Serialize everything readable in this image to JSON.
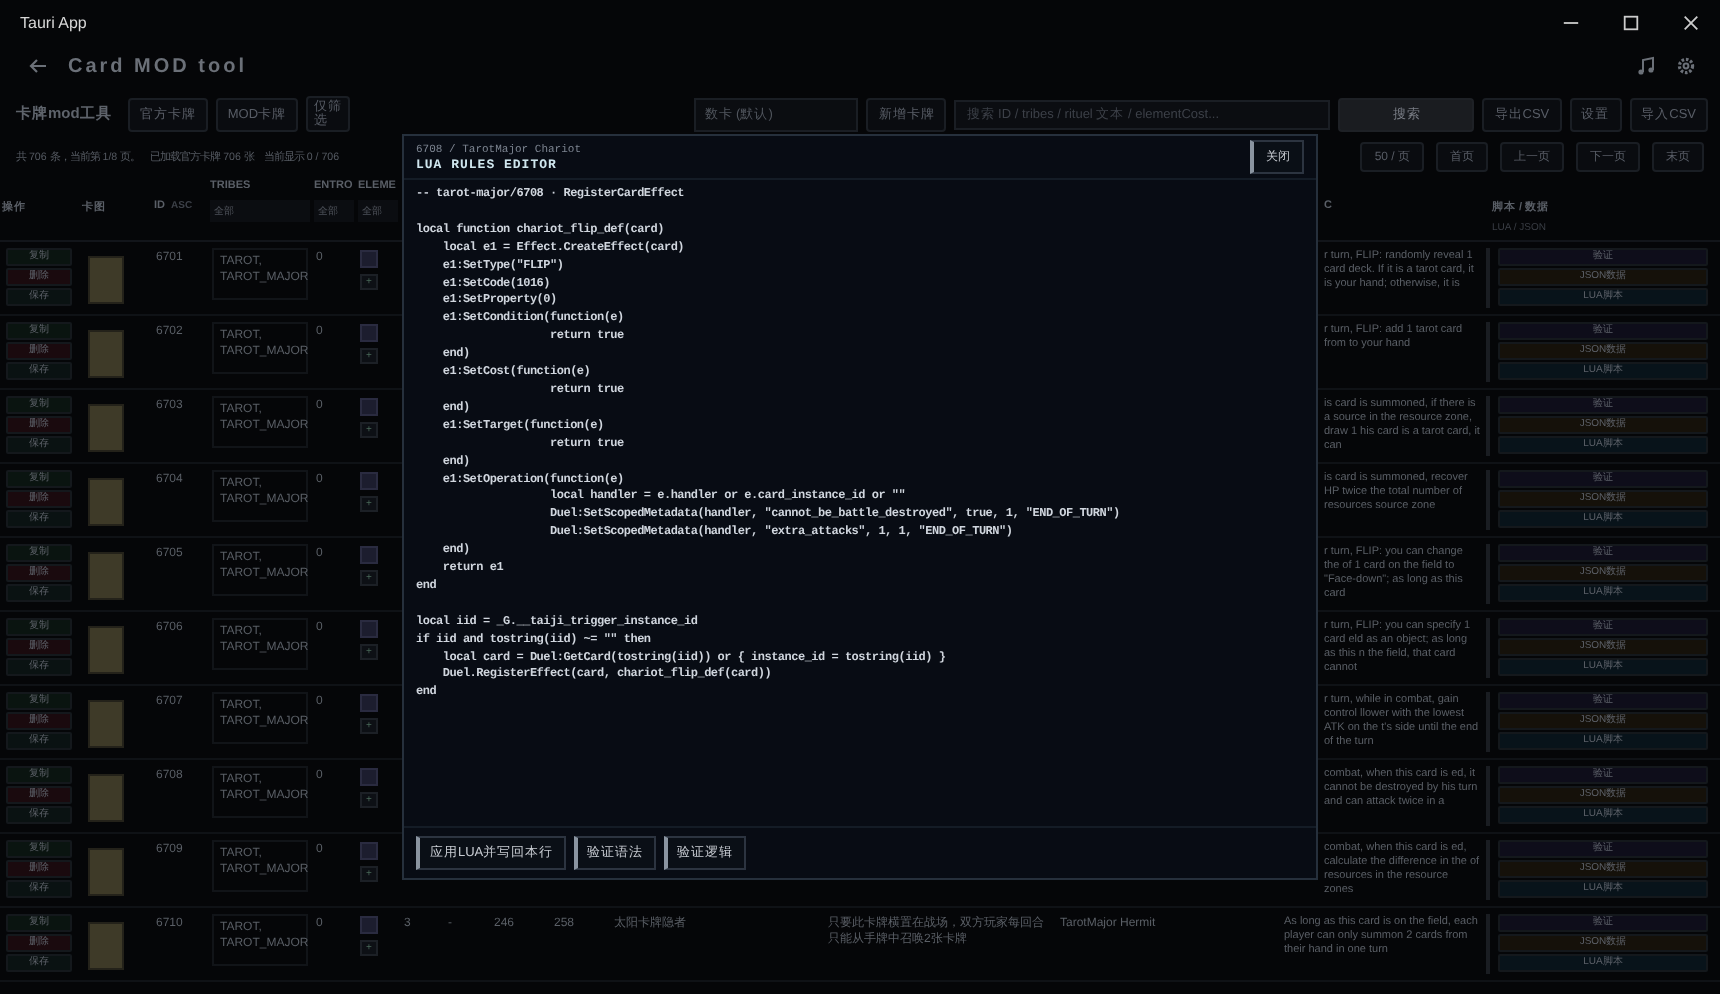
{
  "window": {
    "title": "Tauri App"
  },
  "header": {
    "title": "Card MOD tool"
  },
  "toolbar": {
    "app_label": "卡牌mod工具",
    "tabs": [
      "官方卡牌",
      "MOD卡牌"
    ],
    "filter_button": "仅筛选",
    "deck_select": "数卡 (默认)",
    "add_button": "新增卡牌",
    "search": {
      "placeholder": "搜索 ID / tribes / rituel 文本 / elementCost..."
    },
    "search_button": "搜索",
    "buttons": [
      "导出CSV",
      "设置",
      "导入CSV"
    ]
  },
  "status": [
    "共 706 条，当前第 1/8 页。",
    "已加载官方卡牌 706 张",
    "当前显示 0 / 706"
  ],
  "pagination": {
    "page_size": "50 / 页",
    "buttons": [
      "首页",
      "上一页",
      "下一页",
      "末页"
    ]
  },
  "table": {
    "columns": [
      {
        "label": "操作"
      },
      {
        "label": "卡图"
      },
      {
        "label": "ID",
        "sort": "ASC"
      },
      {
        "label": "TRIBES",
        "filter": "全部"
      },
      {
        "label": "ENTRO",
        "filter": "全部"
      },
      {
        "label": "ELEME",
        "filter": "全部"
      },
      {
        "label": "C"
      },
      {
        "label": "脚本 / 数据",
        "sub": "LUA / JSON"
      }
    ],
    "rows": [
      {
        "id": "6701",
        "actions": [
          "复制",
          "删除",
          "保存"
        ],
        "tribes": "TAROT, TAROT_MAJOR",
        "entro": "0",
        "element_add": "+",
        "effect": "r turn, FLIP: randomly reveal 1 card deck. If it is a tarot card, it is your hand; otherwise, it is",
        "script_actions": [
          "验证",
          "JSON数据",
          "LUA脚本"
        ]
      },
      {
        "id": "6702",
        "actions": [
          "复制",
          "删除",
          "保存"
        ],
        "tribes": "TAROT, TAROT_MAJOR",
        "entro": "0",
        "element_add": "+",
        "effect": "r turn, FLIP: add 1 tarot card from to your hand",
        "script_actions": [
          "验证",
          "JSON数据",
          "LUA脚本"
        ]
      },
      {
        "id": "6703",
        "actions": [
          "复制",
          "删除",
          "保存"
        ],
        "tribes": "TAROT, TAROT_MAJOR",
        "entro": "0",
        "element_add": "+",
        "effect": "is card is summoned, if there is a source in the resource zone, draw 1 his card is a tarot card, it can",
        "script_actions": [
          "验证",
          "JSON数据",
          "LUA脚本"
        ]
      },
      {
        "id": "6704",
        "actions": [
          "复制",
          "删除",
          "保存"
        ],
        "tribes": "TAROT, TAROT_MAJOR",
        "entro": "0",
        "element_add": "+",
        "effect": "is card is summoned, recover HP twice the total number of resources source zone",
        "script_actions": [
          "验证",
          "JSON数据",
          "LUA脚本"
        ]
      },
      {
        "id": "6705",
        "actions": [
          "复制",
          "删除",
          "保存"
        ],
        "tribes": "TAROT, TAROT_MAJOR",
        "entro": "0",
        "element_add": "+",
        "effect": "r turn, FLIP: you can change the of 1 card on the field to \"Face-down\"; as long as this card",
        "script_actions": [
          "验证",
          "JSON数据",
          "LUA脚本"
        ]
      },
      {
        "id": "6706",
        "actions": [
          "复制",
          "删除",
          "保存"
        ],
        "tribes": "TAROT, TAROT_MAJOR",
        "entro": "0",
        "element_add": "+",
        "effect": "r turn, FLIP: you can specify 1 card eld as an object; as long as this n the field, that card cannot",
        "script_actions": [
          "验证",
          "JSON数据",
          "LUA脚本"
        ]
      },
      {
        "id": "6707",
        "actions": [
          "复制",
          "删除",
          "保存"
        ],
        "tribes": "TAROT, TAROT_MAJOR",
        "entro": "0",
        "element_add": "+",
        "effect": "r turn, while in combat, gain control llower with the lowest ATK on the t's side until the end of the turn",
        "script_actions": [
          "验证",
          "JSON数据",
          "LUA脚本"
        ]
      },
      {
        "id": "6708",
        "actions": [
          "复制",
          "删除",
          "保存"
        ],
        "tribes": "TAROT, TAROT_MAJOR",
        "entro": "0",
        "element_add": "+",
        "effect": "combat, when this card is ed, it cannot be destroyed by his turn and can attack twice in a",
        "script_actions": [
          "验证",
          "JSON数据",
          "LUA脚本"
        ]
      },
      {
        "id": "6709",
        "actions": [
          "复制",
          "删除",
          "保存"
        ],
        "tribes": "TAROT, TAROT_MAJOR",
        "entro": "0",
        "element_add": "+",
        "effect": "combat, when this card is ed, calculate the difference in the of resources in the resource zones",
        "script_actions": [
          "验证",
          "JSON数据",
          "LUA脚本"
        ]
      },
      {
        "id": "6710",
        "actions": [
          "复制",
          "删除",
          "保存"
        ],
        "tribes": "TAROT, TAROT_MAJOR",
        "entro": "0",
        "element_add": "+",
        "column_7": "3",
        "column_8": "-",
        "column_9": "246",
        "column_10": "258",
        "column_11": "太阳卡牌隐者",
        "column_12": "只要此卡牌横置在战场，双方玩家每回合只能从手牌中召唤2张卡牌",
        "column_13": "TarotMajor Hermit",
        "effect": "As long as this card is on the field, each player can only summon 2 cards from their hand in one turn",
        "script_actions": [
          "验证",
          "JSON数据",
          "LUA脚本"
        ]
      }
    ]
  },
  "editor": {
    "subtitle": "6708 / TarotMajor Chariot",
    "title": "LUA RULES EDITOR",
    "close_button": "关闭",
    "code": "-- tarot-major/6708 · RegisterCardEffect\n\nlocal function chariot_flip_def(card)\n    local e1 = Effect.CreateEffect(card)\n    e1:SetType(\"FLIP\")\n    e1:SetCode(1016)\n    e1:SetProperty(0)\n    e1:SetCondition(function(e)\n                    return true\n    end)\n    e1:SetCost(function(e)\n                    return true\n    end)\n    e1:SetTarget(function(e)\n                    return true\n    end)\n    e1:SetOperation(function(e)\n                    local handler = e.handler or e.card_instance_id or \"\"\n                    Duel:SetScopedMetadata(handler, \"cannot_be_battle_destroyed\", true, 1, \"END_OF_TURN\")\n                    Duel:SetScopedMetadata(handler, \"extra_attacks\", 1, 1, \"END_OF_TURN\")\n    end)\n    return e1\nend\n\nlocal iid = _G.__taiji_trigger_instance_id\nif iid and tostring(iid) ~= \"\" then\n    local card = Duel:GetCard(tostring(iid)) or { instance_id = tostring(iid) }\n    Duel.RegisterEffect(card, chariot_flip_def(card))\nend",
    "buttons": [
      "应用LUA并写回本行",
      "验证语法",
      "验证逻辑"
    ]
  }
}
